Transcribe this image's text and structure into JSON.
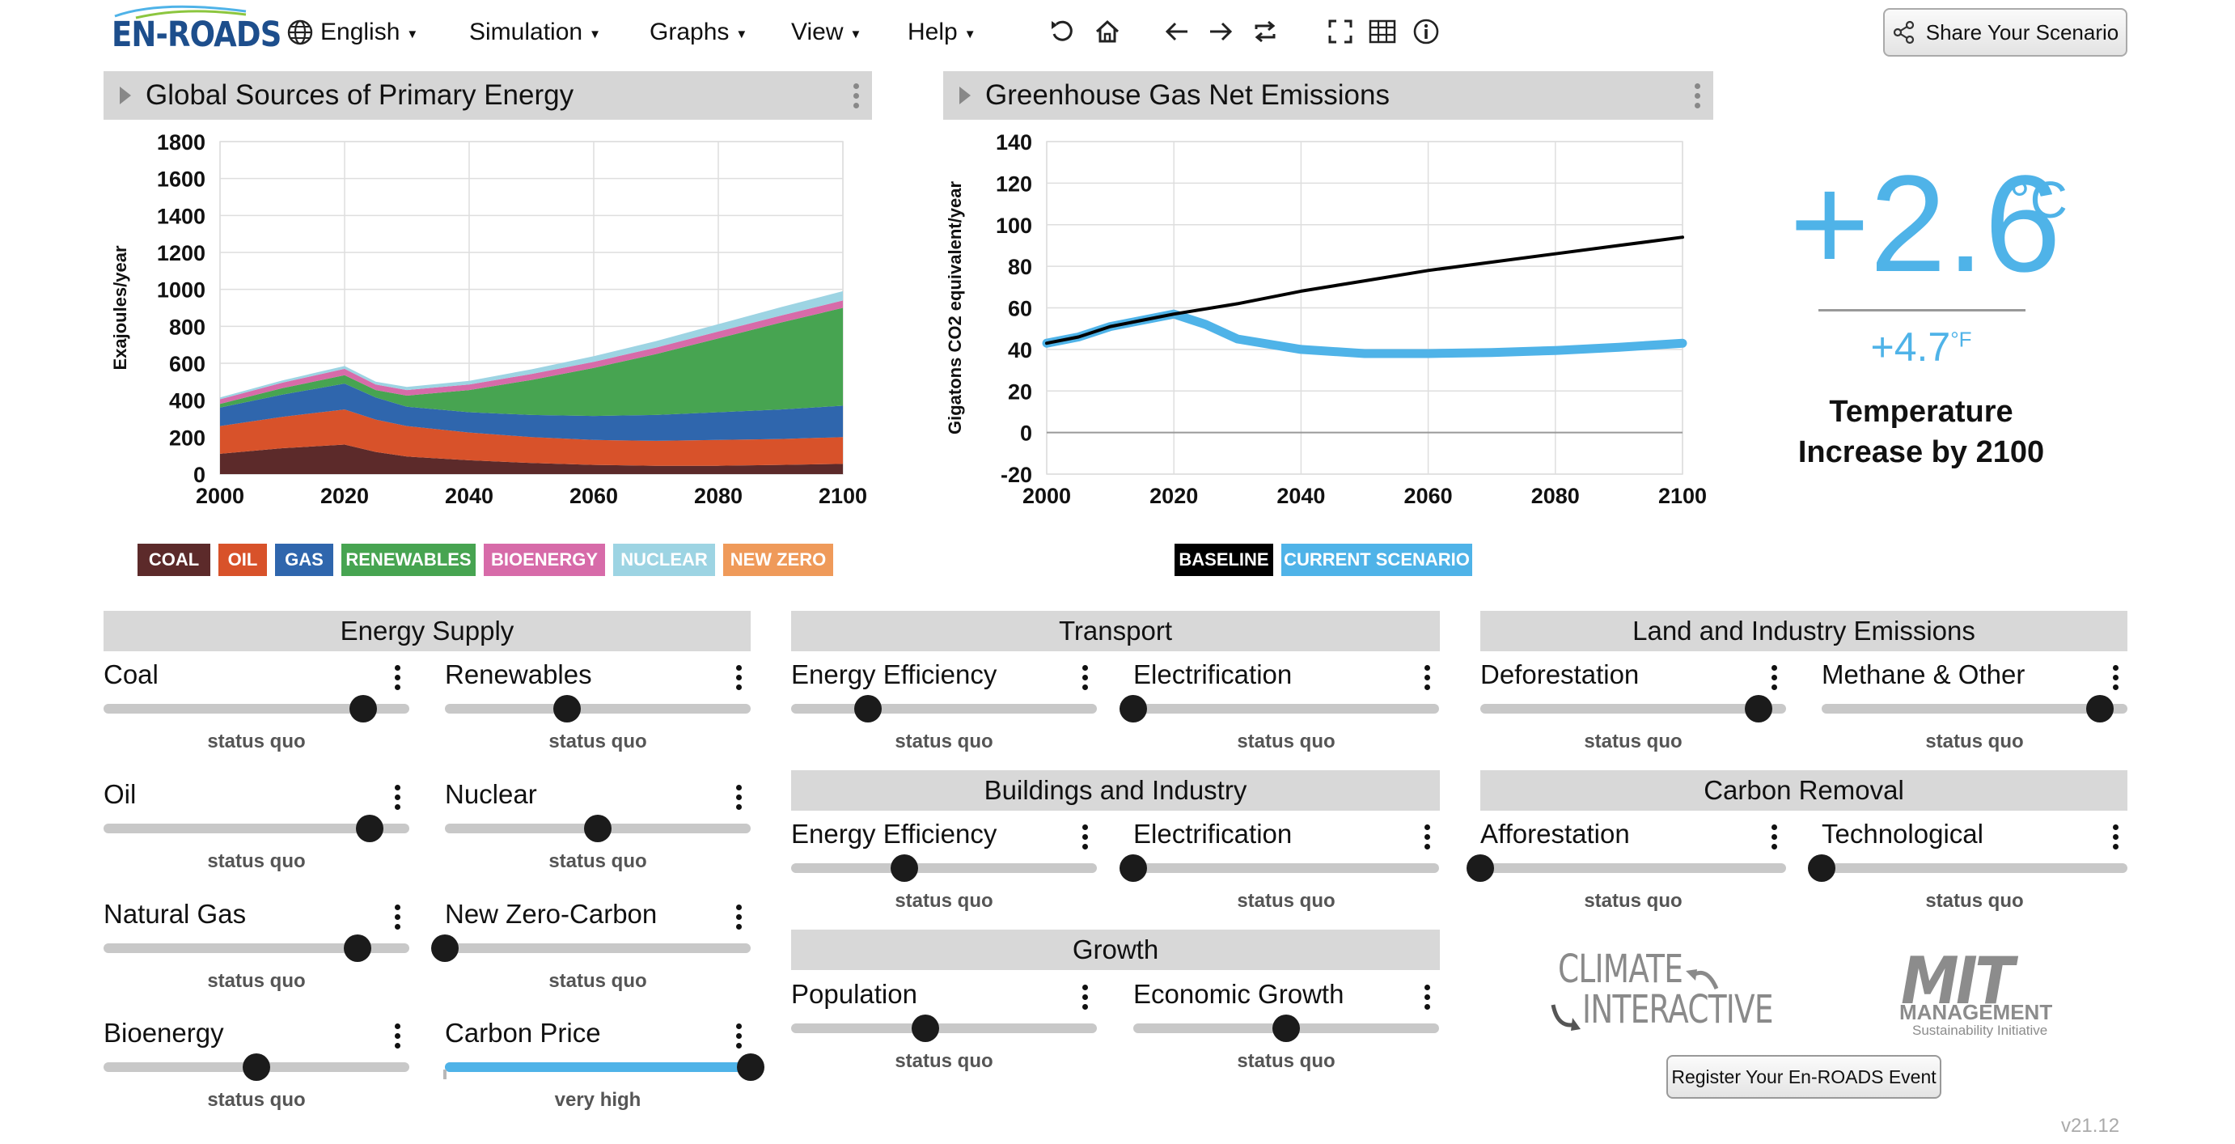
{
  "app": {
    "logo": "EN-ROADS",
    "version": "v21.12"
  },
  "menu": [
    {
      "label": "English",
      "icon": "globe-icon"
    },
    {
      "label": "Simulation"
    },
    {
      "label": "Graphs"
    },
    {
      "label": "View"
    },
    {
      "label": "Help"
    }
  ],
  "toolbar": {
    "icons": [
      "undo-icon",
      "home-icon",
      "back-arrow-icon",
      "forward-arrow-icon",
      "redo-compare-icon",
      "fullscreen-icon",
      "table-icon",
      "info-icon"
    ],
    "share_label": "Share Your Scenario"
  },
  "graph_left": {
    "title": "Global Sources of Primary Energy",
    "legend": [
      {
        "label": "COAL",
        "color": "#5c2a2a"
      },
      {
        "label": "OIL",
        "color": "#d8522a"
      },
      {
        "label": "GAS",
        "color": "#2f66ad"
      },
      {
        "label": "RENEWABLES",
        "color": "#47a451"
      },
      {
        "label": "BIOENERGY",
        "color": "#d76ba9"
      },
      {
        "label": "NUCLEAR",
        "color": "#9dd4e3"
      },
      {
        "label": "NEW ZERO",
        "color": "#ef9a5a"
      }
    ]
  },
  "graph_right": {
    "title": "Greenhouse Gas Net Emissions",
    "legend": [
      {
        "label": "BASELINE",
        "color": "#000000"
      },
      {
        "label": "CURRENT SCENARIO",
        "color": "#4fb3e8"
      }
    ]
  },
  "chart_data": [
    {
      "type": "area",
      "title": "Global Sources of Primary Energy",
      "xlabel": "",
      "ylabel": "Exajoules/year",
      "xlim": [
        2000,
        2100
      ],
      "ylim": [
        0,
        1800
      ],
      "xticks": [
        2000,
        2020,
        2040,
        2060,
        2080,
        2100
      ],
      "yticks": [
        0,
        200,
        400,
        600,
        800,
        1000,
        1200,
        1400,
        1600,
        1800
      ],
      "grid": true,
      "stacked": true,
      "x": [
        2000,
        2010,
        2020,
        2025,
        2030,
        2040,
        2050,
        2060,
        2070,
        2080,
        2090,
        2100
      ],
      "series": [
        {
          "name": "COAL",
          "color": "#5c2a2a",
          "values": [
            110,
            140,
            160,
            120,
            95,
            75,
            60,
            50,
            45,
            45,
            50,
            55
          ]
        },
        {
          "name": "OIL",
          "color": "#d8522a",
          "values": [
            150,
            170,
            190,
            175,
            165,
            150,
            140,
            135,
            135,
            140,
            140,
            145
          ]
        },
        {
          "name": "GAS",
          "color": "#2f66ad",
          "values": [
            100,
            120,
            140,
            120,
            105,
            110,
            120,
            130,
            140,
            150,
            160,
            170
          ]
        },
        {
          "name": "RENEWABLES",
          "color": "#47a451",
          "values": [
            20,
            35,
            45,
            40,
            60,
            120,
            190,
            260,
            330,
            400,
            470,
            530
          ]
        },
        {
          "name": "BIOENERGY",
          "color": "#d76ba9",
          "values": [
            25,
            30,
            35,
            30,
            30,
            30,
            32,
            33,
            35,
            37,
            38,
            40
          ]
        },
        {
          "name": "NUCLEAR",
          "color": "#9dd4e3",
          "values": [
            10,
            12,
            15,
            15,
            17,
            20,
            25,
            30,
            35,
            40,
            45,
            50
          ]
        },
        {
          "name": "NEW ZERO",
          "color": "#ef9a5a",
          "values": [
            0,
            0,
            0,
            0,
            0,
            0,
            0,
            0,
            0,
            0,
            0,
            0
          ]
        }
      ]
    },
    {
      "type": "line",
      "title": "Greenhouse Gas Net Emissions",
      "xlabel": "",
      "ylabel": "Gigatons CO2 equivalent/year",
      "xlim": [
        2000,
        2100
      ],
      "ylim": [
        -20,
        140
      ],
      "xticks": [
        2000,
        2020,
        2040,
        2060,
        2080,
        2100
      ],
      "yticks": [
        -20,
        0,
        20,
        40,
        60,
        80,
        100,
        120,
        140
      ],
      "grid": true,
      "series": [
        {
          "name": "BASELINE",
          "color": "#000000",
          "x": [
            2000,
            2005,
            2010,
            2015,
            2020,
            2030,
            2040,
            2050,
            2060,
            2070,
            2080,
            2090,
            2100
          ],
          "values": [
            43,
            46,
            51,
            54,
            57,
            62,
            68,
            73,
            78,
            82,
            86,
            90,
            94
          ]
        },
        {
          "name": "CURRENT SCENARIO",
          "color": "#4fb3e8",
          "x": [
            2000,
            2005,
            2010,
            2015,
            2020,
            2025,
            2030,
            2040,
            2050,
            2060,
            2070,
            2080,
            2090,
            2100
          ],
          "values": [
            43,
            46,
            51,
            54,
            57,
            52,
            45,
            40,
            38,
            38,
            38.5,
            39.5,
            41,
            43
          ]
        }
      ]
    }
  ],
  "temperature": {
    "celsius": "+2.6",
    "celsius_unit": "°C",
    "fahrenheit": "+4.7",
    "fahrenheit_unit": "°F",
    "label": "Temperature Increase by 2100"
  },
  "sections": [
    {
      "key": "energy_supply",
      "title": "Energy Supply"
    },
    {
      "key": "transport",
      "title": "Transport"
    },
    {
      "key": "land_industry",
      "title": "Land and Industry Emissions"
    },
    {
      "key": "buildings",
      "title": "Buildings and Industry"
    },
    {
      "key": "carbon_removal",
      "title": "Carbon Removal"
    },
    {
      "key": "growth",
      "title": "Growth"
    }
  ],
  "sliders": [
    {
      "label": "Coal",
      "status": "status quo",
      "value": 0.85,
      "default": 0.85
    },
    {
      "label": "Renewables",
      "status": "status quo",
      "value": 0.4,
      "default": 0.4
    },
    {
      "label": "Oil",
      "status": "status quo",
      "value": 0.87,
      "default": 0.87
    },
    {
      "label": "Nuclear",
      "status": "status quo",
      "value": 0.5,
      "default": 0.5
    },
    {
      "label": "Natural Gas",
      "status": "status quo",
      "value": 0.83,
      "default": 0.83
    },
    {
      "label": "New Zero-Carbon",
      "status": "status quo",
      "value": 0.0,
      "default": 0.0
    },
    {
      "label": "Bioenergy",
      "status": "status quo",
      "value": 0.5,
      "default": 0.5
    },
    {
      "label": "Carbon Price",
      "status": "very high",
      "value": 1.0,
      "default": 0.0,
      "active": true
    },
    {
      "label": "Energy Efficiency",
      "status": "status quo",
      "value": 0.25,
      "default": 0.25
    },
    {
      "label": "Electrification",
      "status": "status quo",
      "value": 0.0,
      "default": 0.0
    },
    {
      "label": "Energy Efficiency",
      "status": "status quo",
      "value": 0.37,
      "default": 0.37
    },
    {
      "label": "Electrification",
      "status": "status quo",
      "value": 0.0,
      "default": 0.0
    },
    {
      "label": "Population",
      "status": "status quo",
      "value": 0.44,
      "default": 0.44
    },
    {
      "label": "Economic Growth",
      "status": "status quo",
      "value": 0.5,
      "default": 0.5
    },
    {
      "label": "Deforestation",
      "status": "status quo",
      "value": 0.91,
      "default": 0.91
    },
    {
      "label": "Methane & Other",
      "status": "status quo",
      "value": 0.91,
      "default": 0.91
    },
    {
      "label": "Afforestation",
      "status": "status quo",
      "value": 0.0,
      "default": 0.0
    },
    {
      "label": "Technological",
      "status": "status quo",
      "value": 0.0,
      "default": 0.0
    }
  ],
  "partners": {
    "climate_interactive_line1": "CLIMATE",
    "climate_interactive_line2": "INTERACTIVE",
    "mit_line1": "MIT",
    "mit_line2": "MANAGEMENT",
    "mit_line3": "Sustainability Initiative"
  },
  "register_label": "Register Your En-ROADS Event"
}
